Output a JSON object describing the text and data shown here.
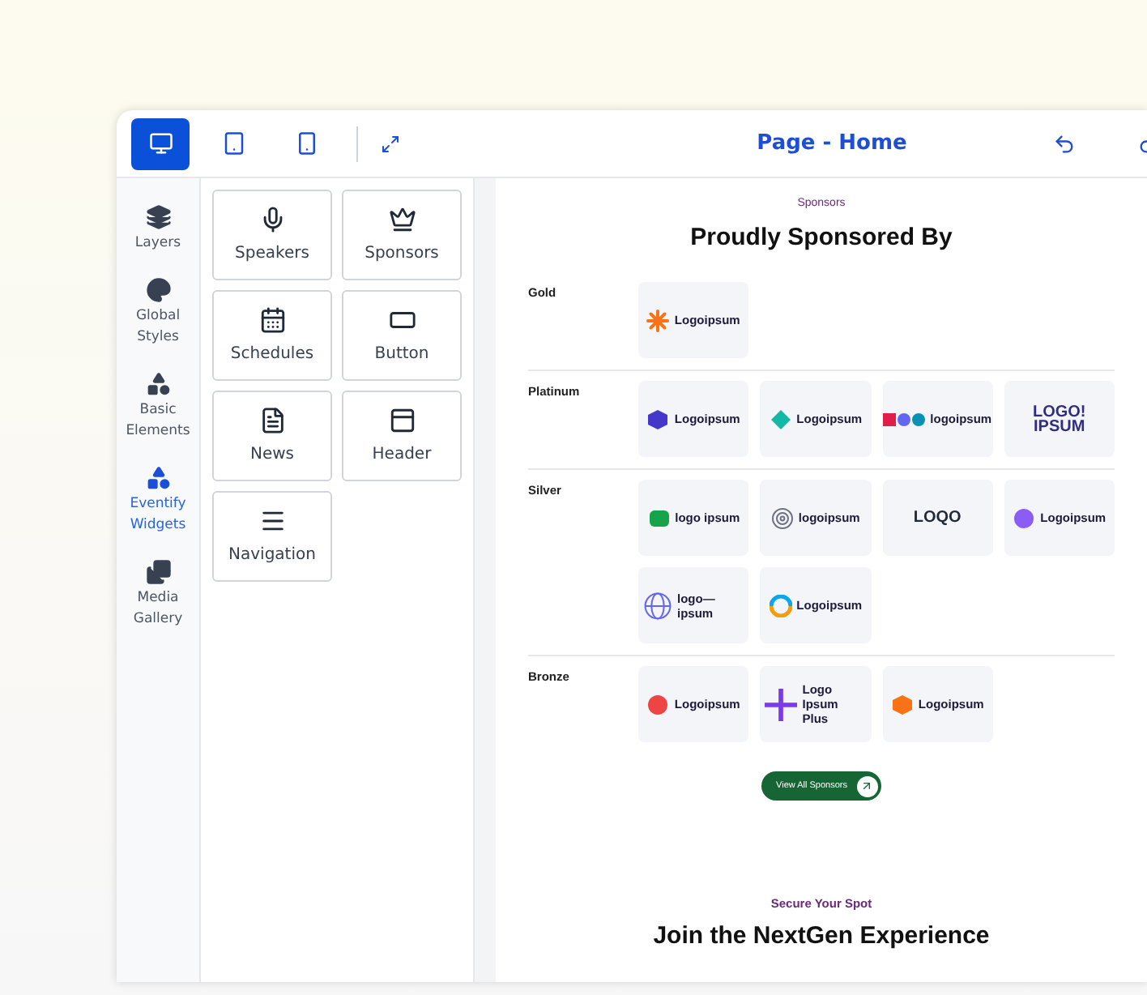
{
  "toolbar": {
    "devices": [
      {
        "kind": "desktop",
        "selected": true
      },
      {
        "kind": "tablet",
        "selected": false
      },
      {
        "kind": "phone",
        "selected": false
      }
    ],
    "title": "Page - Home"
  },
  "rail": [
    {
      "kind": "layers",
      "label": "Layers",
      "selected": false
    },
    {
      "kind": "styles",
      "label": "Global Styles",
      "selected": false
    },
    {
      "kind": "elements",
      "label": "Basic Elements",
      "selected": false
    },
    {
      "kind": "widgets",
      "label": "Eventify Widgets",
      "selected": true
    },
    {
      "kind": "media",
      "label": "Media Gallery",
      "selected": false
    }
  ],
  "widgets": [
    {
      "kind": "mic",
      "label": "Speakers"
    },
    {
      "kind": "crown",
      "label": "Sponsors"
    },
    {
      "kind": "calendar",
      "label": "Schedules"
    },
    {
      "kind": "button",
      "label": "Button"
    },
    {
      "kind": "document",
      "label": "News"
    },
    {
      "kind": "window",
      "label": "Header"
    },
    {
      "kind": "menu",
      "label": "Navigation"
    }
  ],
  "sponsors": {
    "eyebrow": "Sponsors",
    "title": "Proudly Sponsored By",
    "tiers": [
      {
        "name": "Gold",
        "logos": [
          {
            "kind": "burst",
            "color": "#f97316",
            "text": "Logoipsum"
          }
        ]
      },
      {
        "name": "Platinum",
        "logos": [
          {
            "kind": "hexagon",
            "color": "#4338ca",
            "text": "Logoipsum"
          },
          {
            "kind": "diamond",
            "color": "#14b8a6",
            "text": "Logoipsum"
          },
          {
            "kind": "shapes",
            "color": "#e11d48",
            "text": "logoipsum"
          },
          {
            "kind": "none",
            "color": "#312e81",
            "text": "LOGO! IPSUM"
          }
        ]
      },
      {
        "name": "Silver",
        "logos": [
          {
            "kind": "badge",
            "color": "#16a34a",
            "text": "logo ipsum"
          },
          {
            "kind": "rings",
            "color": "#6b7280",
            "text": "logoipsum"
          },
          {
            "kind": "none",
            "color": "#1f2937",
            "text": "LOQO"
          },
          {
            "kind": "circle",
            "color": "#8b5cf6",
            "text": "Logoipsum"
          },
          {
            "kind": "globe",
            "color": "#6366f1",
            "text": "logo— ipsum"
          },
          {
            "kind": "swirl",
            "color": "#f59e0b",
            "text": "Logoipsum"
          }
        ]
      },
      {
        "name": "Bronze",
        "logos": [
          {
            "kind": "circle",
            "color": "#ef4444",
            "text": "Logoipsum"
          },
          {
            "kind": "cross",
            "color": "#7c3aed",
            "text": "Logo Ipsum Plus"
          },
          {
            "kind": "hexagon",
            "color": "#f97316",
            "text": "Logoipsum"
          }
        ]
      }
    ],
    "button": "View All Sponsors"
  },
  "tickets": {
    "eyebrow": "Secure Your Spot",
    "title": "Join the NextGen Experience"
  }
}
